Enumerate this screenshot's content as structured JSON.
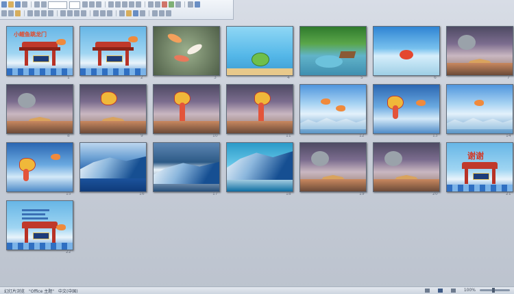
{
  "status_bar": {
    "view": "幻灯片浏览",
    "theme": "\"Office 主题\"",
    "language": "中文(中国)",
    "zoom": "100%"
  },
  "toolbar": {
    "row1_icons": [
      "new-icon",
      "open-icon",
      "save-icon",
      "print-icon",
      "undo-icon",
      "redo-icon",
      "font-box",
      "size-box",
      "bold-icon",
      "italic-icon",
      "underline-icon",
      "align-left-icon",
      "align-center-icon",
      "align-right-icon",
      "bullets-icon",
      "numbering-icon",
      "indent-icon",
      "outdent-icon",
      "color-icon",
      "picture-icon",
      "shapes-icon",
      "zoom-icon",
      "help-icon"
    ],
    "row2_icons": [
      "cut-icon",
      "copy-icon",
      "paste-icon",
      "format-painter-icon",
      "bold-icon",
      "italic-icon",
      "shadow-icon",
      "strike-icon",
      "superscript-icon",
      "subscript-icon",
      "align-icon",
      "text-direction-icon",
      "line-spacing-icon",
      "columns-icon",
      "arrange-icon",
      "quick-styles-icon",
      "fill-icon",
      "outline-icon",
      "effects-icon",
      "find-icon",
      "replace-icon",
      "select-icon"
    ]
  },
  "slides": [
    {
      "number": "1",
      "theme": "gate-title",
      "title": "小鲤鱼跳龙门"
    },
    {
      "number": "2",
      "theme": "gate"
    },
    {
      "number": "3",
      "theme": "koi"
    },
    {
      "number": "4",
      "theme": "sea-turtle"
    },
    {
      "number": "5",
      "theme": "jungle-pond"
    },
    {
      "number": "6",
      "theme": "beach-crab"
    },
    {
      "number": "7",
      "theme": "storm-carp"
    },
    {
      "number": "8",
      "theme": "storm-carp"
    },
    {
      "number": "9",
      "theme": "storm-dragon"
    },
    {
      "number": "10",
      "theme": "storm-dragon"
    },
    {
      "number": "11",
      "theme": "storm-dragon"
    },
    {
      "number": "12",
      "theme": "fishes-waves"
    },
    {
      "number": "13",
      "theme": "dragon-fishes"
    },
    {
      "number": "14",
      "theme": "fishes-waves"
    },
    {
      "number": "15",
      "theme": "dragon-sky"
    },
    {
      "number": "16",
      "theme": "wave"
    },
    {
      "number": "17",
      "theme": "wave-storm"
    },
    {
      "number": "18",
      "theme": "wave-tube"
    },
    {
      "number": "19",
      "theme": "storm-carp"
    },
    {
      "number": "20",
      "theme": "storm-carp"
    },
    {
      "number": "21",
      "theme": "gate-thanks",
      "title": "谢谢"
    },
    {
      "number": "22",
      "theme": "gate-text"
    }
  ]
}
